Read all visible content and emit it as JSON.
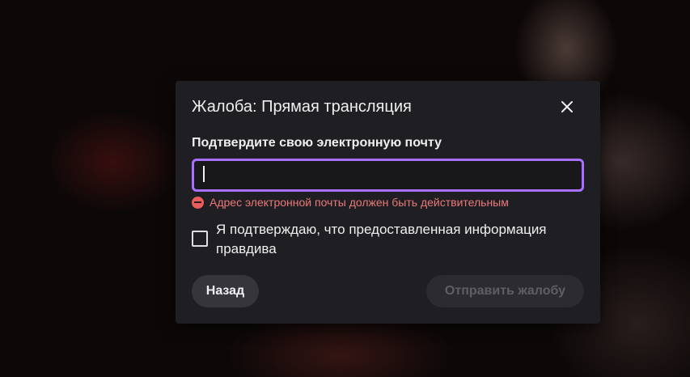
{
  "dialog": {
    "title": "Жалоба: Прямая трансляция",
    "close_icon": "close-icon",
    "email_label": "Подтвердите свою электронную почту",
    "email_value": "",
    "email_placeholder": "",
    "error_icon": "error-minus-circle-icon",
    "error_text": "Адрес электронной почты должен быть действительным",
    "confirm_checkbox_checked": false,
    "confirm_label": "Я подтверждаю, что предоставленная информация правдива",
    "back_label": "Назад",
    "submit_label": "Отправить жалобу",
    "submit_disabled": true
  },
  "colors": {
    "accent_focus": "#a970ff",
    "error": "#eb5d5d",
    "dialog_bg": "#1f1f23"
  }
}
